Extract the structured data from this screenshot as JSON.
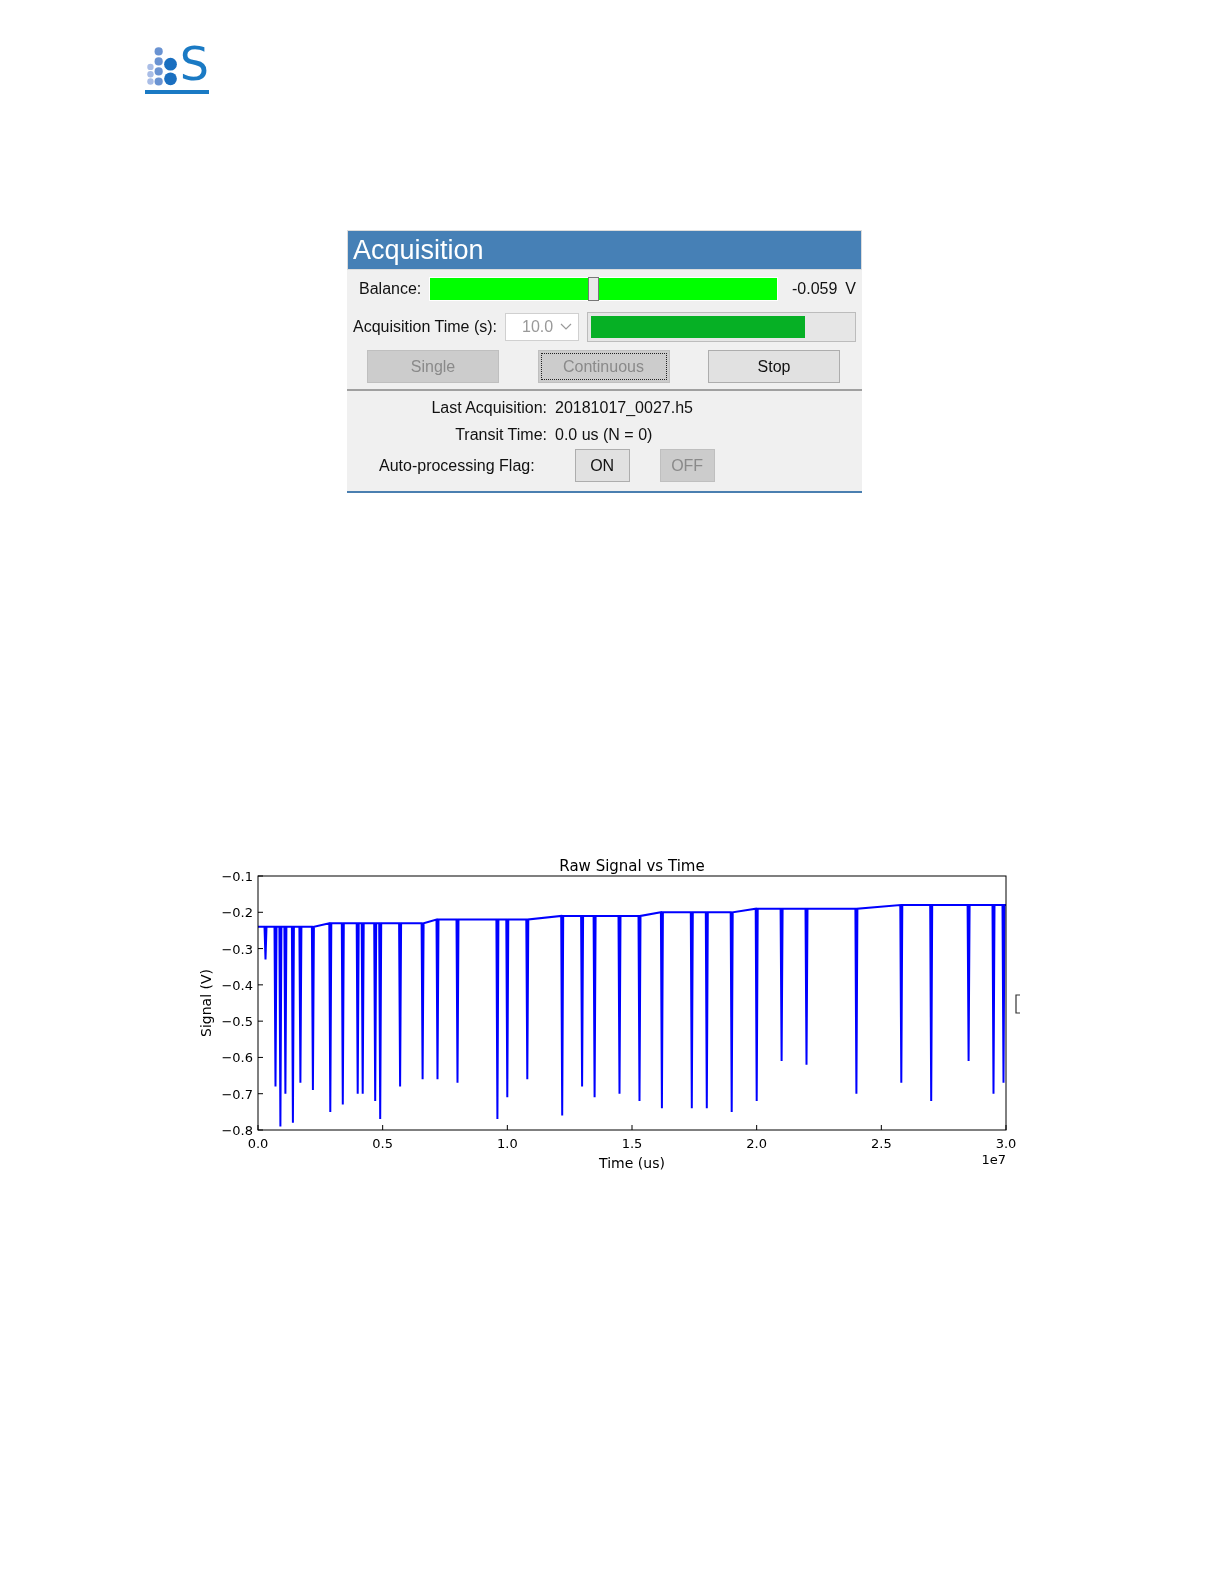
{
  "logo": {
    "letter": "S"
  },
  "panel": {
    "title": "Acquisition",
    "balance": {
      "label": "Balance:",
      "level": 0.47,
      "reading": "-0.059",
      "unit": "V"
    },
    "acquisition_time": {
      "label": "Acquisition Time (s):",
      "value": "10.0",
      "disabled": true,
      "level": 0.82
    },
    "buttons": [
      {
        "label": "Single",
        "disabled": true,
        "focused": false
      },
      {
        "label": "Continuous",
        "disabled": true,
        "focused": true
      },
      {
        "label": "Stop",
        "disabled": false,
        "focused": false
      }
    ],
    "info": [
      {
        "label": "Last Acquisition:",
        "value": "20181017_0027.h5"
      },
      {
        "label": "Transit Time:",
        "value": "0.0 us (N = 0)"
      }
    ],
    "flag": {
      "label": "Auto-processing Flag:",
      "buttons": [
        {
          "label": "ON",
          "disabled": false
        },
        {
          "label": "OFF",
          "disabled": true
        }
      ]
    }
  },
  "figure": {
    "chart_data": {
      "type": "line",
      "title": "Raw Signal vs Time",
      "xlabel": "Time (us)",
      "ylabel": "Signal (V)",
      "x": [
        0,
        0.026,
        0.03,
        0.034,
        0.066,
        0.07,
        0.074,
        0.086,
        0.09,
        0.094,
        0.106,
        0.11,
        0.114,
        0.136,
        0.14,
        0.144,
        0.166,
        0.17,
        0.174,
        0.216,
        0.22,
        0.224,
        0.286,
        0.29,
        0.294,
        0.336,
        0.34,
        0.344,
        0.396,
        0.4,
        0.404,
        0.416,
        0.42,
        0.424,
        0.466,
        0.47,
        0.474,
        0.486,
        0.49,
        0.494,
        0.566,
        0.57,
        0.574,
        0.656,
        0.66,
        0.664,
        0.716,
        0.72,
        0.724,
        0.796,
        0.8,
        0.804,
        0.956,
        0.96,
        0.964,
        0.996,
        1.0,
        1.004,
        1.076,
        1.08,
        1.084,
        1.216,
        1.22,
        1.224,
        1.296,
        1.3,
        1.304,
        1.346,
        1.35,
        1.354,
        1.446,
        1.45,
        1.454,
        1.526,
        1.53,
        1.534,
        1.616,
        1.62,
        1.624,
        1.736,
        1.74,
        1.744,
        1.796,
        1.8,
        1.804,
        1.896,
        1.9,
        1.904,
        1.996,
        2.0,
        2.004,
        2.096,
        2.1,
        2.104,
        2.196,
        2.2,
        2.204,
        2.396,
        2.4,
        2.404,
        2.576,
        2.58,
        2.584,
        2.696,
        2.7,
        2.704,
        2.846,
        2.85,
        2.854,
        2.946,
        2.95,
        2.954,
        2.986,
        2.99,
        2.994,
        3.0
      ],
      "series": [
        {
          "color": "#0000ff",
          "values": [
            -0.24,
            -0.24,
            -0.33,
            -0.24,
            -0.24,
            -0.68,
            -0.24,
            -0.24,
            -0.79,
            -0.24,
            -0.24,
            -0.7,
            -0.24,
            -0.24,
            -0.78,
            -0.24,
            -0.24,
            -0.67,
            -0.24,
            -0.24,
            -0.69,
            -0.24,
            -0.23,
            -0.75,
            -0.23,
            -0.23,
            -0.73,
            -0.23,
            -0.23,
            -0.7,
            -0.23,
            -0.23,
            -0.7,
            -0.23,
            -0.23,
            -0.72,
            -0.23,
            -0.23,
            -0.77,
            -0.23,
            -0.23,
            -0.68,
            -0.23,
            -0.23,
            -0.66,
            -0.23,
            -0.22,
            -0.66,
            -0.22,
            -0.22,
            -0.67,
            -0.22,
            -0.22,
            -0.77,
            -0.22,
            -0.22,
            -0.71,
            -0.22,
            -0.22,
            -0.66,
            -0.22,
            -0.21,
            -0.76,
            -0.21,
            -0.21,
            -0.68,
            -0.21,
            -0.21,
            -0.71,
            -0.21,
            -0.21,
            -0.7,
            -0.21,
            -0.21,
            -0.72,
            -0.21,
            -0.2,
            -0.74,
            -0.2,
            -0.2,
            -0.74,
            -0.2,
            -0.2,
            -0.74,
            -0.2,
            -0.2,
            -0.75,
            -0.2,
            -0.19,
            -0.72,
            -0.19,
            -0.19,
            -0.61,
            -0.19,
            -0.19,
            -0.62,
            -0.19,
            -0.19,
            -0.7,
            -0.19,
            -0.18,
            -0.67,
            -0.18,
            -0.18,
            -0.72,
            -0.18,
            -0.18,
            -0.61,
            -0.18,
            -0.18,
            -0.7,
            -0.18,
            -0.18,
            -0.67,
            -0.18,
            -0.18
          ]
        }
      ],
      "xlim": [
        0,
        3
      ],
      "ylim": [
        -0.8,
        -0.1
      ],
      "xticks": [
        {
          "value": 0,
          "label": "0.0"
        },
        {
          "value": 0.5,
          "label": "0.5"
        },
        {
          "value": 1,
          "label": "1.0"
        },
        {
          "value": 1.5,
          "label": "1.5"
        },
        {
          "value": 2,
          "label": "2.0"
        },
        {
          "value": 2.5,
          "label": "2.5"
        },
        {
          "value": 3,
          "label": "3.0"
        }
      ],
      "yticks": [
        {
          "value": -0.1,
          "label": "−0.1"
        },
        {
          "value": -0.2,
          "label": "−0.2"
        },
        {
          "value": -0.3,
          "label": "−0.3"
        },
        {
          "value": -0.4,
          "label": "−0.4"
        },
        {
          "value": -0.5,
          "label": "−0.5"
        },
        {
          "value": -0.6,
          "label": "−0.6"
        },
        {
          "value": -0.7,
          "label": "−0.7"
        },
        {
          "value": -0.8,
          "label": "−0.8"
        }
      ],
      "annotations": [
        "1e7"
      ]
    }
  }
}
